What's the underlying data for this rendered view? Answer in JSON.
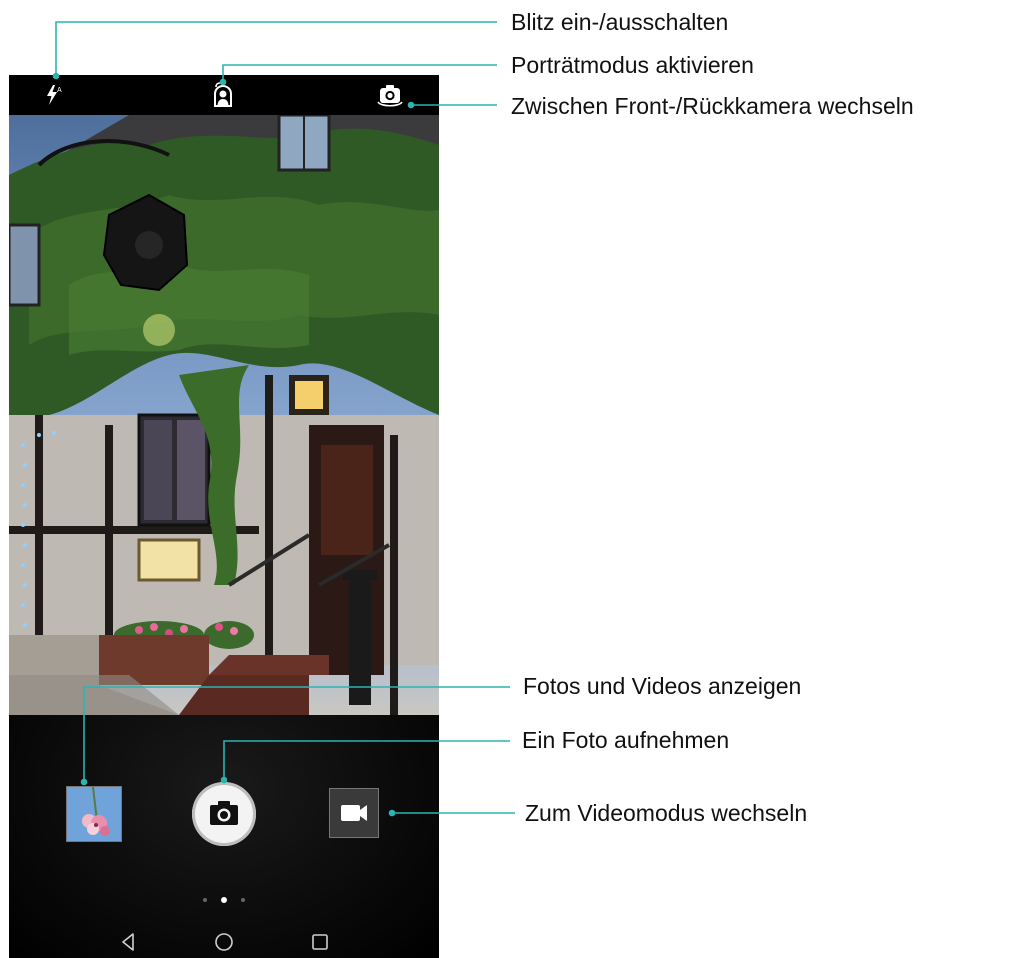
{
  "callouts": {
    "flash": "Blitz ein-/ausschalten",
    "portrait": "Porträtmodus aktivieren",
    "switch_camera": "Zwischen Front-/Rückkamera wechseln",
    "gallery": "Fotos und Videos anzeigen",
    "take_photo": "Ein Foto aufnehmen",
    "video_mode": "Zum Videomodus wechseln"
  },
  "colors": {
    "callout_line": "#2bb5b0",
    "phone_background": "#000000",
    "text": "#111111"
  },
  "icons": {
    "flash": "flash-auto-icon",
    "portrait": "portrait-mode-icon",
    "switch_camera": "switch-camera-icon",
    "shutter": "camera-icon",
    "video": "video-camera-icon",
    "back": "nav-back-icon",
    "home": "nav-home-icon",
    "recent": "nav-recent-icon"
  },
  "mode_pager": {
    "pages": 3,
    "active_index": 1
  }
}
